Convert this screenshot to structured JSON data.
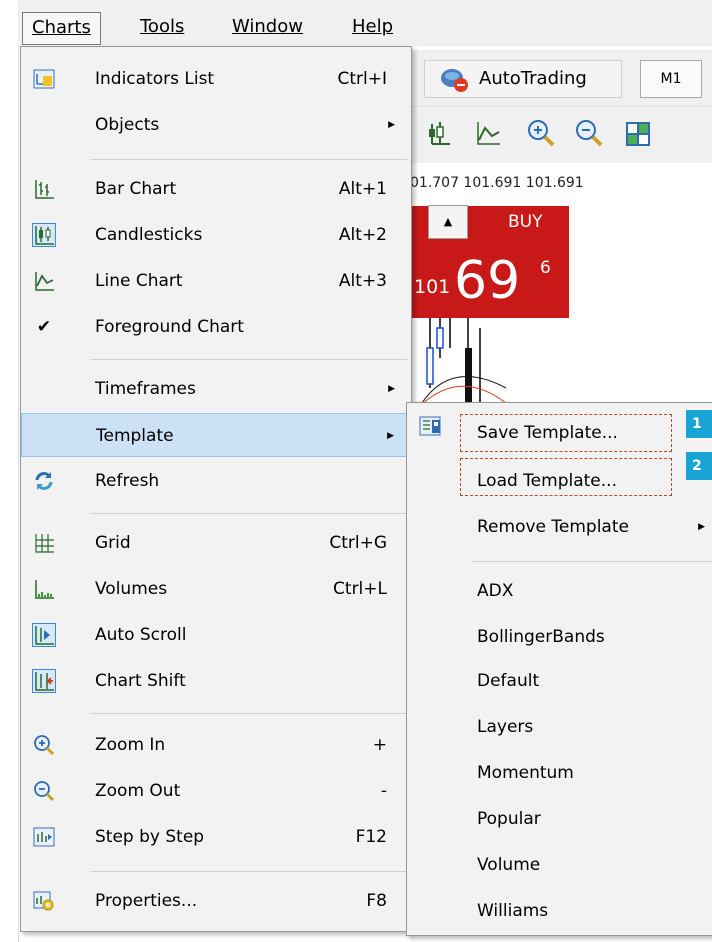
{
  "menubar": {
    "charts": "Charts",
    "tools": "Tools",
    "window": "Window",
    "help": "Help"
  },
  "toolbar": {
    "autotrading": "AutoTrading",
    "timeframe": "M1"
  },
  "quotes": "01.707 101.691 101.691",
  "buy_panel": {
    "label": "BUY",
    "prefix": "101",
    "big": "69",
    "sup": "6"
  },
  "main_menu": {
    "items": [
      {
        "label": "Indicators List",
        "shortcut": "Ctrl+I",
        "icon": "indicators-list-icon"
      },
      {
        "label": "Objects",
        "shortcut": "",
        "icon": ""
      },
      {
        "label": "Bar Chart",
        "shortcut": "Alt+1",
        "icon": "bar-chart-icon"
      },
      {
        "label": "Candlesticks",
        "shortcut": "Alt+2",
        "icon": "candlesticks-icon"
      },
      {
        "label": "Line Chart",
        "shortcut": "Alt+3",
        "icon": "line-chart-icon"
      },
      {
        "label": "Foreground Chart",
        "shortcut": "",
        "icon": "checkmark-icon"
      },
      {
        "label": "Timeframes",
        "shortcut": "",
        "icon": ""
      },
      {
        "label": "Template",
        "shortcut": "",
        "icon": ""
      },
      {
        "label": "Refresh",
        "shortcut": "",
        "icon": "refresh-icon"
      },
      {
        "label": "Grid",
        "shortcut": "Ctrl+G",
        "icon": "grid-icon"
      },
      {
        "label": "Volumes",
        "shortcut": "Ctrl+L",
        "icon": "volumes-icon"
      },
      {
        "label": "Auto Scroll",
        "shortcut": "",
        "icon": "auto-scroll-icon"
      },
      {
        "label": "Chart Shift",
        "shortcut": "",
        "icon": "chart-shift-icon"
      },
      {
        "label": "Zoom In",
        "shortcut": "+",
        "icon": "zoom-in-icon"
      },
      {
        "label": "Zoom Out",
        "shortcut": "-",
        "icon": "zoom-out-icon"
      },
      {
        "label": "Step by Step",
        "shortcut": "F12",
        "icon": "step-by-step-icon"
      },
      {
        "label": "Properties...",
        "shortcut": "F8",
        "icon": "properties-icon"
      }
    ]
  },
  "template_menu": {
    "save": "Save Template...",
    "load": "Load Template...",
    "remove": "Remove Template",
    "templates": [
      "ADX",
      "BollingerBands",
      "Default",
      "Layers",
      "Momentum",
      "Popular",
      "Volume",
      "Williams"
    ]
  },
  "badges": {
    "one": "1",
    "two": "2"
  },
  "colors": {
    "menu_bg": "#f2f2f2",
    "highlight": "#cce1f5",
    "buy_red": "#c81818",
    "badge_blue": "#1aa4d6",
    "dashed_outline": "#b5492a"
  }
}
